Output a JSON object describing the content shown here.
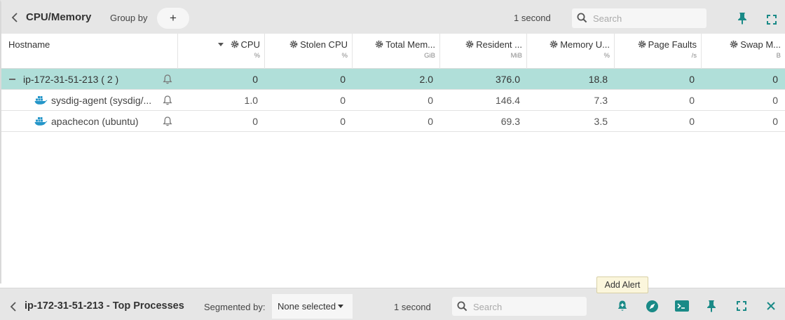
{
  "top_panel": {
    "title": "CPU/Memory",
    "group_by_label": "Group by",
    "add_label": "+",
    "interval": "1 second",
    "search_placeholder": "Search"
  },
  "table": {
    "columns": [
      {
        "label": "Hostname",
        "unit": ""
      },
      {
        "label": "CPU",
        "unit": "%"
      },
      {
        "label": "Stolen CPU",
        "unit": "%"
      },
      {
        "label": "Total Mem...",
        "unit": "GiB"
      },
      {
        "label": "Resident ...",
        "unit": "MiB"
      },
      {
        "label": "Memory U...",
        "unit": "%"
      },
      {
        "label": "Page Faults",
        "unit": "/s"
      },
      {
        "label": "Swap M...",
        "unit": "B"
      }
    ],
    "rows": [
      {
        "name": "ip-172-31-51-213 ( 2 )",
        "values": [
          "0",
          "0",
          "2.0",
          "376.0",
          "18.8",
          "0",
          "0"
        ]
      },
      {
        "name": "sysdig-agent (sysdig/...",
        "values": [
          "1.0",
          "0",
          "0",
          "146.4",
          "7.3",
          "0",
          "0"
        ]
      },
      {
        "name": "apachecon (ubuntu)",
        "values": [
          "0",
          "0",
          "0",
          "69.3",
          "3.5",
          "0",
          "0"
        ]
      }
    ]
  },
  "bottom_panel": {
    "title": "ip-172-31-51-213 - Top Processes",
    "segmented_by_label": "Segmented by:",
    "segmented_value": "None selected",
    "interval": "1 second",
    "search_placeholder": "Search"
  },
  "tooltip": "Add Alert",
  "colors": {
    "accent": "#1a8a87",
    "selected_row": "#b0dfd9",
    "header_bg": "#e6e6e6"
  },
  "icons": [
    "chevron-left-icon",
    "search-icon",
    "pin-icon",
    "expand-icon",
    "gear-icon",
    "bell-icon",
    "container-whale-icon",
    "add-alert-icon",
    "explore-icon",
    "terminal-icon",
    "close-icon"
  ]
}
